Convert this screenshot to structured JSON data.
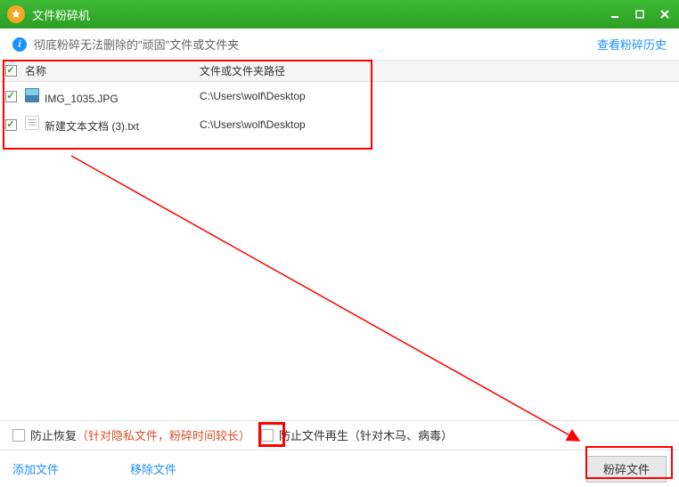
{
  "titlebar": {
    "title": "文件粉碎机"
  },
  "info_bar": {
    "text": "彻底粉碎无法删除的\"顽固\"文件或文件夹",
    "history_link": "查看粉碎历史"
  },
  "list": {
    "header": {
      "name": "名称",
      "path": "文件或文件夹路径"
    },
    "rows": [
      {
        "checked": true,
        "icon": "image",
        "name": "IMG_1035.JPG",
        "path": "C:\\Users\\wolf\\Desktop"
      },
      {
        "checked": true,
        "icon": "text",
        "name": "新建文本文档 (3).txt",
        "path": "C:\\Users\\wolf\\Desktop"
      }
    ]
  },
  "options": {
    "prevent_recover_label": "防止恢复",
    "prevent_recover_note": "（针对隐私文件，粉碎时间较长）",
    "prevent_regen_label": "防止文件再生（针对木马、病毒）"
  },
  "bottom": {
    "add_files": "添加文件",
    "remove_files": "移除文件",
    "shred": "粉碎文件"
  }
}
